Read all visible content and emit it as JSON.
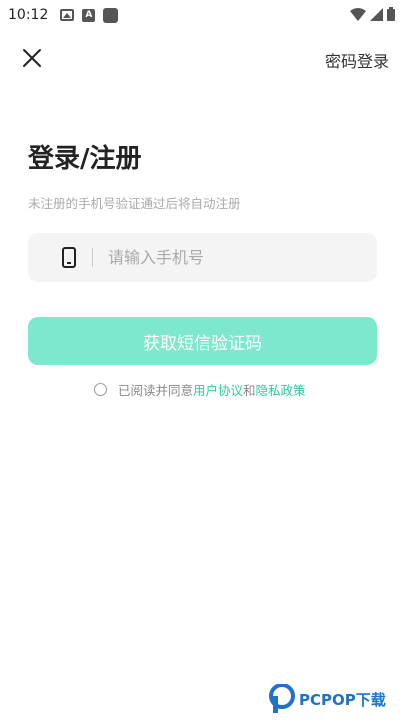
{
  "status_bar": {
    "time": "10:12",
    "icons": [
      "image-icon",
      "a-icon",
      "square-icon",
      "wifi-icon",
      "signal-icon",
      "battery-icon"
    ]
  },
  "header": {
    "password_login": "密码登录"
  },
  "main": {
    "title": "登录/注册",
    "subtitle": "未注册的手机号验证通过后将自动注册",
    "phone_placeholder": "请输入手机号",
    "get_code_button": "获取短信验证码"
  },
  "agreement": {
    "prefix": "已阅读并同意",
    "user_agreement": "用户协议",
    "and": "和",
    "privacy_policy": "隐私政策"
  },
  "watermark": {
    "text": "PCPOP下载"
  },
  "colors": {
    "accent": "#7ee8cd",
    "link": "#2ccca0",
    "input_bg": "#f4f4f4",
    "watermark": "#1e73c8"
  }
}
